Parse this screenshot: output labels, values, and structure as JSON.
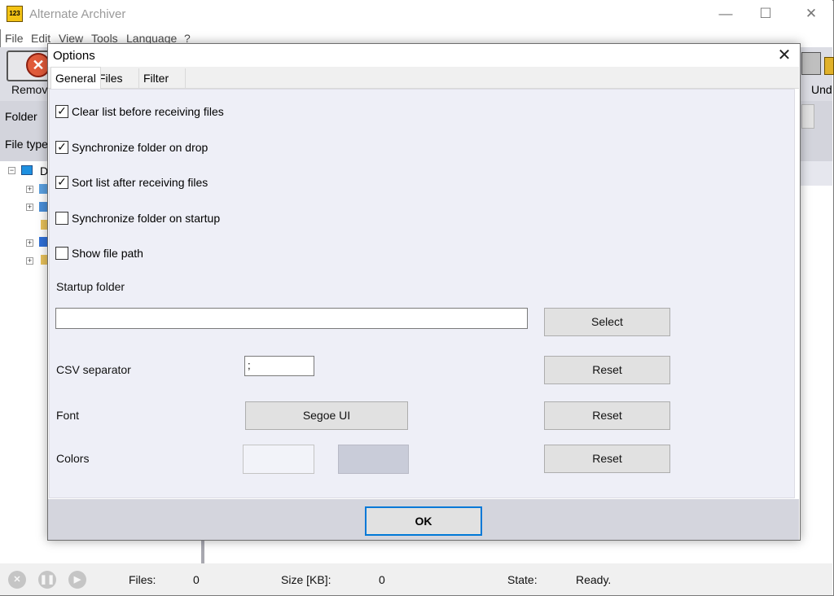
{
  "app": {
    "title": "Alternate Archiver",
    "controls": {
      "minimize": "—",
      "maximize": "☐",
      "close": "✕"
    }
  },
  "menu": [
    "File",
    "Edit",
    "View",
    "Tools",
    "Language",
    "?"
  ],
  "toolbar": {
    "remove_label": "Remov",
    "undo_label": "Und"
  },
  "filter_panel": {
    "folder_label": "Folder",
    "filetype_label": "File type"
  },
  "tree": {
    "root_label": "D"
  },
  "dialog": {
    "title": "Options",
    "close_glyph": "✕",
    "tabs": [
      "General",
      "Files",
      "Filter"
    ],
    "active_tab": "General",
    "checkboxes": [
      {
        "label": "Clear list before receiving files",
        "checked": true
      },
      {
        "label": "Synchronize folder on drop",
        "checked": true
      },
      {
        "label": "Sort list after receiving files",
        "checked": true
      },
      {
        "label": "Synchronize folder on startup",
        "checked": false
      },
      {
        "label": "Show file path",
        "checked": false
      }
    ],
    "startup_folder": {
      "label": "Startup folder",
      "value": "",
      "select_label": "Select"
    },
    "csv_separator": {
      "label": "CSV separator",
      "value": ";",
      "reset_label": "Reset"
    },
    "font": {
      "label": "Font",
      "value": "Segoe UI",
      "reset_label": "Reset"
    },
    "colors": {
      "label": "Colors",
      "color1": "#f2f3f9",
      "color2": "#c9ccd9",
      "reset_label": "Reset"
    },
    "ok_label": "OK"
  },
  "status": {
    "files_label": "Files:",
    "files_value": "0",
    "size_label": "Size [KB]:",
    "size_value": "0",
    "state_label": "State:",
    "state_value": "Ready."
  }
}
